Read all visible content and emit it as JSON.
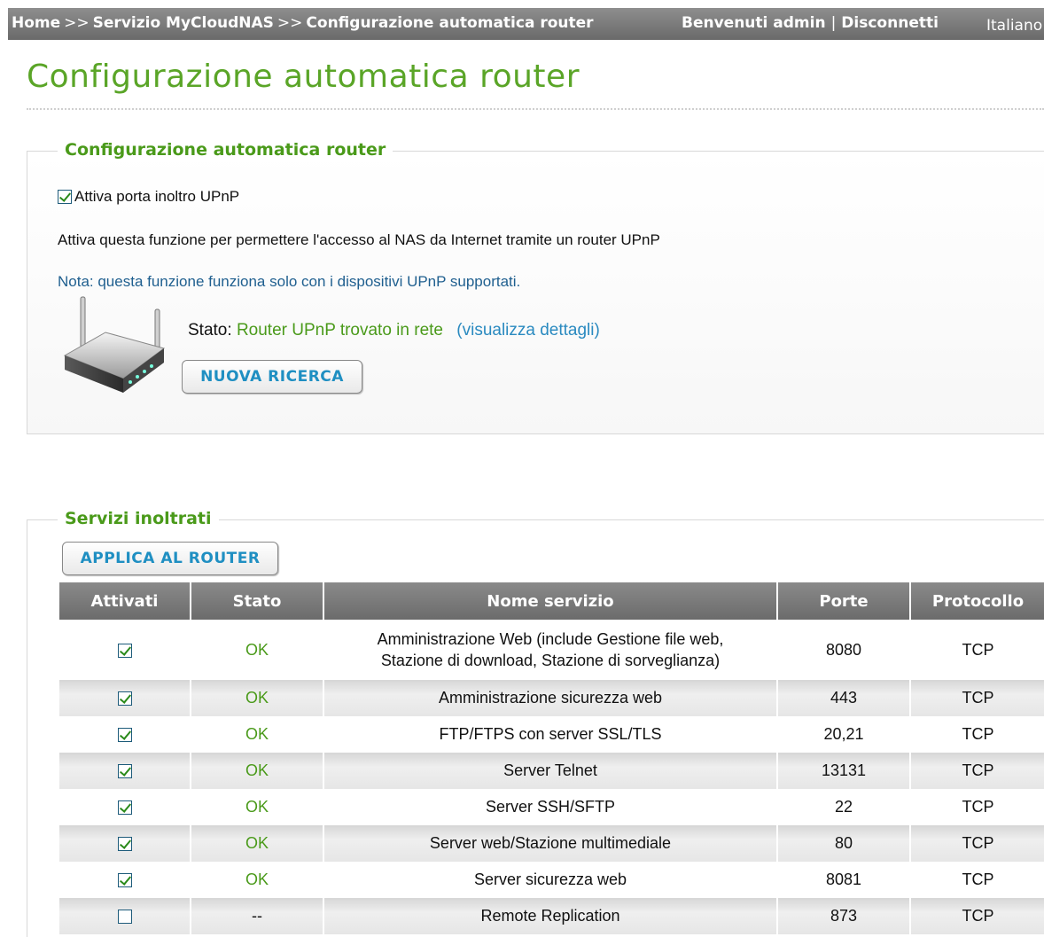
{
  "topbar": {
    "crumb_home": "Home",
    "sep": ">>",
    "crumb_service": "Servizio MyCloudNAS",
    "crumb_current": "Configurazione automatica router",
    "welcome": "Benvenuti admin",
    "bar": "|",
    "logout": "Disconnetti",
    "language": "Italiano"
  },
  "page_title": "Configurazione automatica router",
  "router_section": {
    "legend": "Configurazione automatica router",
    "upnp_checkbox_label": "Attiva porta inoltro UPnP",
    "upnp_checked": true,
    "description": "Attiva questa funzione per permettere l'accesso al NAS da Internet tramite un router UPnP",
    "note": "Nota: questa funzione funziona solo con i dispositivi UPnP supportati.",
    "status_label": "Stato:",
    "status_value": "Router UPnP trovato in rete",
    "details_link": "(visualizza dettagli)",
    "search_button": "NUOVA RICERCA"
  },
  "services_section": {
    "legend": "Servizi inoltrati",
    "apply_button": "APPLICA AL ROUTER",
    "columns": [
      "Attivati",
      "Stato",
      "Nome servizio",
      "Porte",
      "Protocollo"
    ],
    "rows": [
      {
        "enabled": true,
        "status": "OK",
        "name": "Amministrazione Web (include Gestione file web,",
        "name2": "Stazione di download, Stazione di sorveglianza)",
        "ports": "8080",
        "protocol": "TCP"
      },
      {
        "enabled": true,
        "status": "OK",
        "name": "Amministrazione sicurezza web",
        "ports": "443",
        "protocol": "TCP"
      },
      {
        "enabled": true,
        "status": "OK",
        "name": "FTP/FTPS con server SSL/TLS",
        "ports": "20,21",
        "protocol": "TCP"
      },
      {
        "enabled": true,
        "status": "OK",
        "name": "Server Telnet",
        "ports": "13131",
        "protocol": "TCP"
      },
      {
        "enabled": true,
        "status": "OK",
        "name": "Server SSH/SFTP",
        "ports": "22",
        "protocol": "TCP"
      },
      {
        "enabled": true,
        "status": "OK",
        "name": "Server web/Stazione multimediale",
        "ports": "80",
        "protocol": "TCP"
      },
      {
        "enabled": true,
        "status": "OK",
        "name": "Server sicurezza web",
        "ports": "8081",
        "protocol": "TCP"
      },
      {
        "enabled": false,
        "status": "--",
        "name": "Remote Replication",
        "ports": "873",
        "protocol": "TCP"
      }
    ]
  },
  "colors": {
    "title_green": "#5aa527",
    "status_green": "#4a9a1a",
    "link_blue": "#2a8ac0",
    "button_text": "#1f8fc2",
    "header_gray": "#6b6b6b"
  }
}
